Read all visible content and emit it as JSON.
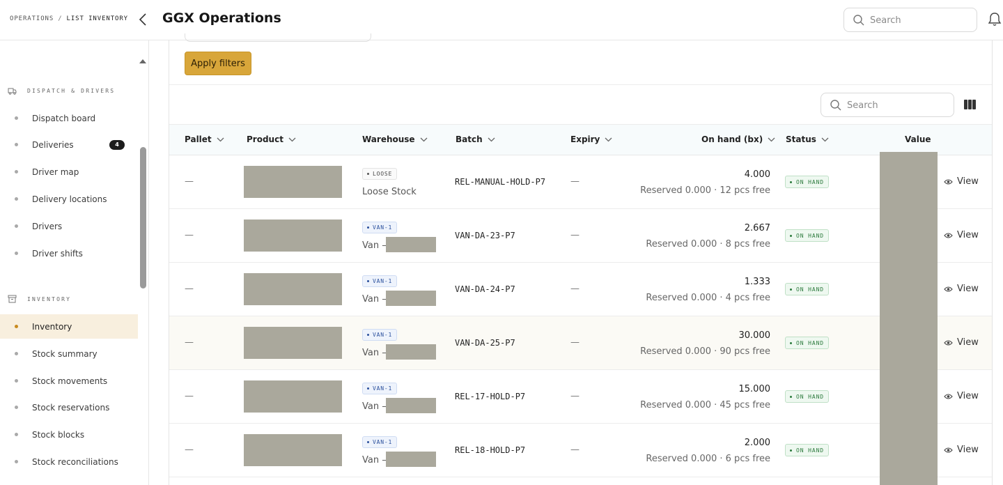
{
  "breadcrumb": {
    "root": "OPERATIONS",
    "separator": "/",
    "current": "LIST INVENTORY"
  },
  "app": {
    "title": "GGX Operations"
  },
  "header": {
    "search_placeholder": "Search"
  },
  "sidebar": {
    "sections": [
      {
        "title": "DISPATCH & DRIVERS",
        "icon": "truck-icon",
        "items": [
          {
            "label": "Dispatch board"
          },
          {
            "label": "Deliveries",
            "badge": "4"
          },
          {
            "label": "Driver map"
          },
          {
            "label": "Delivery locations"
          },
          {
            "label": "Drivers"
          },
          {
            "label": "Driver shifts"
          }
        ]
      },
      {
        "title": "INVENTORY",
        "icon": "archive-box-icon",
        "items": [
          {
            "label": "Inventory",
            "active": true
          },
          {
            "label": "Stock summary"
          },
          {
            "label": "Stock movements"
          },
          {
            "label": "Stock reservations"
          },
          {
            "label": "Stock blocks"
          },
          {
            "label": "Stock reconciliations"
          }
        ]
      }
    ]
  },
  "filters": {
    "apply_label": "Apply filters"
  },
  "table": {
    "search_placeholder": "Search",
    "columns": [
      "Pallet",
      "Product",
      "Warehouse",
      "Batch",
      "Expiry",
      "On hand (bx)",
      "Status",
      "Value"
    ],
    "rows": [
      {
        "pallet": "—",
        "warehouse_tag": "LOOSE",
        "warehouse_name": "Loose Stock",
        "batch": "REL-MANUAL-HOLD-P7",
        "expiry": "—",
        "on_hand": "4.000",
        "reserved": "Reserved 0.000 · 12 pcs free",
        "status": "ON HAND",
        "action": "View"
      },
      {
        "pallet": "—",
        "warehouse_tag": "VAN-1",
        "warehouse_name": "Van —",
        "batch": "VAN-DA-23-P7",
        "expiry": "—",
        "on_hand": "2.667",
        "reserved": "Reserved 0.000 · 8 pcs free",
        "status": "ON HAND",
        "action": "View"
      },
      {
        "pallet": "—",
        "warehouse_tag": "VAN-1",
        "warehouse_name": "Van —",
        "batch": "VAN-DA-24-P7",
        "expiry": "—",
        "on_hand": "1.333",
        "reserved": "Reserved 0.000 · 4 pcs free",
        "status": "ON HAND",
        "action": "View"
      },
      {
        "pallet": "—",
        "warehouse_tag": "VAN-1",
        "warehouse_name": "Van —",
        "batch": "VAN-DA-25-P7",
        "expiry": "—",
        "on_hand": "30.000",
        "reserved": "Reserved 0.000 · 90 pcs free",
        "status": "ON HAND",
        "action": "View"
      },
      {
        "pallet": "—",
        "warehouse_tag": "VAN-1",
        "warehouse_name": "Van —",
        "batch": "REL-17-HOLD-P7",
        "expiry": "—",
        "on_hand": "15.000",
        "reserved": "Reserved 0.000 · 45 pcs free",
        "status": "ON HAND",
        "action": "View"
      },
      {
        "pallet": "—",
        "warehouse_tag": "VAN-1",
        "warehouse_name": "Van —",
        "batch": "REL-18-HOLD-P7",
        "expiry": "—",
        "on_hand": "2.000",
        "reserved": "Reserved 0.000 · 6 pcs free",
        "status": "ON HAND",
        "action": "View"
      }
    ]
  },
  "colors": {
    "accent": "#d8a63a",
    "active_nav_bg": "#f8efde",
    "status_green": "#2b7a3c",
    "van_blue": "#2a4f9c",
    "redaction": "#aaa89c"
  }
}
